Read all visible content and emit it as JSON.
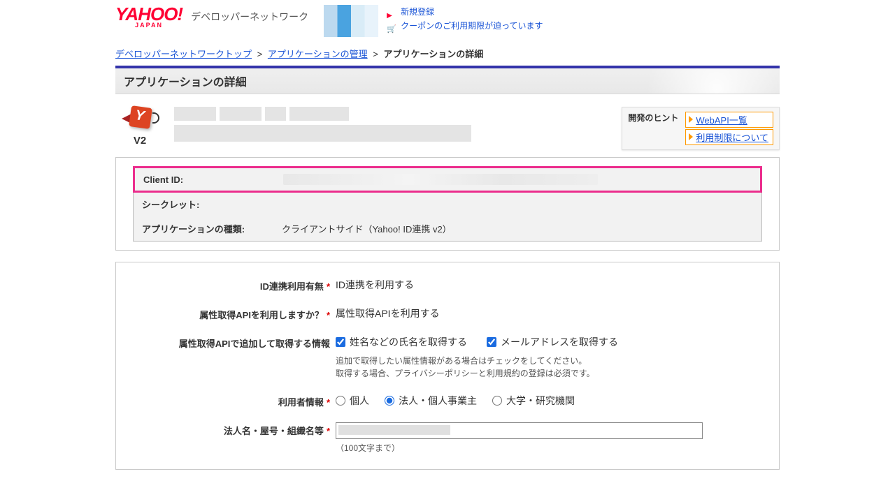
{
  "header": {
    "logo_main": "YAHOO!",
    "logo_sub": "JAPAN",
    "logo_tagline": "デベロッパーネットワーク",
    "link_register": "新規登録",
    "link_coupon": "クーポンのご利用期限が迫っています"
  },
  "breadcrumb": {
    "top": "デベロッパーネットワークトップ",
    "manage": "アプリケーションの管理",
    "current": "アプリケーションの詳細",
    "sep": ">"
  },
  "page_title": "アプリケーションの詳細",
  "app": {
    "version": "V2"
  },
  "hints": {
    "title": "開発のヒント",
    "link_webapi": "WebAPI一覧",
    "link_limit": "利用制限について"
  },
  "credentials": {
    "client_id_label": "Client ID:",
    "secret_label": "シークレット:",
    "type_label": "アプリケーションの種類:",
    "type_value": "クライアントサイド（Yahoo! ID連携 v2）"
  },
  "form": {
    "id_link": {
      "label": "ID連携利用有無",
      "value": "ID連携を利用する"
    },
    "attr_api": {
      "label": "属性取得APIを利用しますか？",
      "value": "属性取得APIを利用する"
    },
    "attr_extra": {
      "label": "属性取得APIで追加して取得する情報",
      "opt_name": "姓名などの氏名を取得する",
      "opt_email": "メールアドレスを取得する",
      "hint1": "追加で取得したい属性情報がある場合はチェックをしてください。",
      "hint2": "取得する場合、プライバシーポリシーと利用規約の登録は必須です。"
    },
    "user_type": {
      "label": "利用者情報",
      "opt_personal": "個人",
      "opt_corp": "法人・個人事業主",
      "opt_univ": "大学・研究機関"
    },
    "org_name": {
      "label": "法人名・屋号・組織名等",
      "note": "（100文字まで）"
    }
  }
}
